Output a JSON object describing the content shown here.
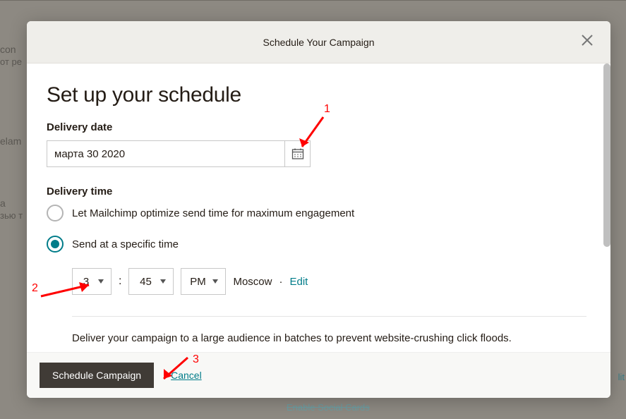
{
  "modal": {
    "header_title": "Schedule Your Campaign",
    "h1": "Set up your schedule",
    "delivery_date_label": "Delivery date",
    "date_value": "марта 30 2020",
    "delivery_time_label": "Delivery time",
    "radio_optimize": "Let Mailchimp optimize send time for maximum engagement",
    "radio_specific": "Send at a specific time",
    "hour": "3",
    "minute": "45",
    "ampm": "PM",
    "colon": ":",
    "timezone": "Moscow",
    "tz_sep": " · ",
    "edit": "Edit",
    "batch_text": "Deliver your campaign to a large audience in batches to prevent website-crushing click floods.",
    "schedule_btn": "Schedule Campaign",
    "cancel": "Cancel"
  },
  "annotations": {
    "a1": "1",
    "a2": "2",
    "a3": "3"
  },
  "bg": {
    "f1": "con",
    "f2": "от ре",
    "f3": "elam",
    "f4": "a",
    "f5": "зью т",
    "f6": "lit",
    "f7": "Enable Social Cards"
  }
}
